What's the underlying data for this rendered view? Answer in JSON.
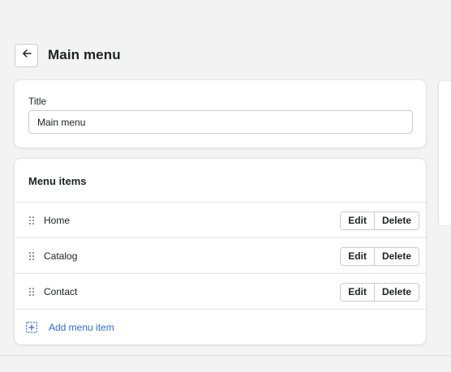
{
  "header": {
    "title": "Main menu"
  },
  "title_card": {
    "label": "Title",
    "value": "Main menu"
  },
  "menu_card": {
    "heading": "Menu items",
    "items": [
      {
        "label": "Home",
        "edit": "Edit",
        "delete": "Delete"
      },
      {
        "label": "Catalog",
        "edit": "Edit",
        "delete": "Delete"
      },
      {
        "label": "Contact",
        "edit": "Edit",
        "delete": "Delete"
      }
    ],
    "add_label": "Add menu item"
  },
  "icons": {
    "back": "arrow-left-icon",
    "drag": "drag-handle-icon",
    "add": "add-square-icon"
  },
  "colors": {
    "link": "#2c6ecb",
    "background": "#f3f3f3",
    "card": "#ffffff",
    "border": "#c9cccf"
  }
}
